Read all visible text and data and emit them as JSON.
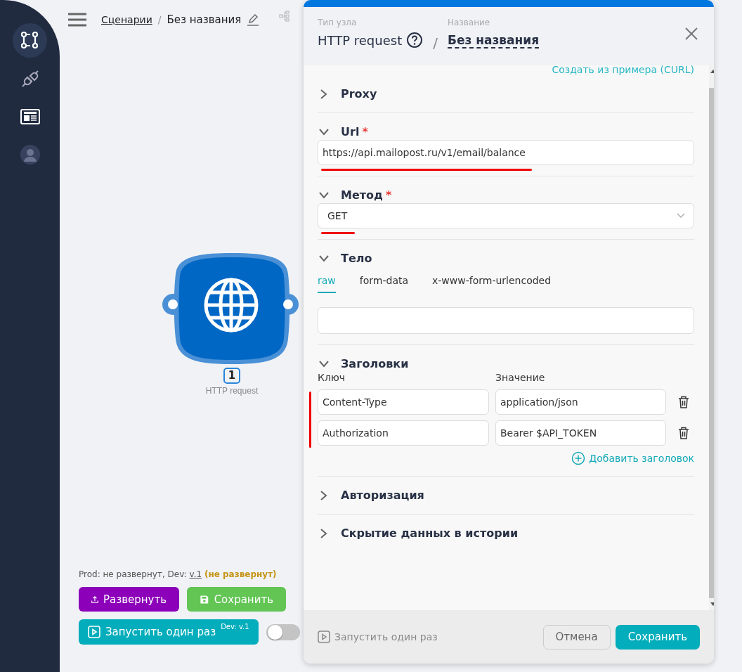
{
  "sidebar": {
    "items": [
      {
        "kind": "scenarios",
        "selected": true
      },
      {
        "kind": "plug",
        "selected": false
      },
      {
        "kind": "news",
        "selected": false
      },
      {
        "kind": "avatar",
        "selected": false
      }
    ]
  },
  "breadcrumb": {
    "link": "Сценарии",
    "separator": "/",
    "current": "Без названия"
  },
  "node": {
    "badge": "1",
    "label": "HTTP request"
  },
  "status": {
    "text": "Prod: не развернут, Dev: ",
    "version": "v.1",
    "state": "(не развернут)"
  },
  "actions": {
    "deploy": "Развернуть",
    "save": "Сохранить",
    "run": "Запустить один раз",
    "run_tag": "Dev: v.1"
  },
  "toggle": {
    "on": false
  },
  "panel": {
    "type_label": "Тип узла",
    "type": "HTTP request",
    "separator": "/",
    "name_label": "Название",
    "name": "Без названия",
    "curl_link": "Создать из примера (CURL)",
    "sections": [
      {
        "title": "Proxy",
        "expanded": false
      },
      {
        "kind": "url",
        "title": "Url",
        "expanded": true,
        "mark": "*",
        "value": "https://api.mailopost.ru/v1/email/balance"
      },
      {
        "kind": "method",
        "title": "Метод",
        "expanded": true,
        "mark": "*",
        "value": "GET"
      },
      {
        "kind": "body",
        "title": "Тело",
        "expanded": true,
        "tabs": [
          {
            "label": "raw",
            "selected": true
          },
          {
            "label": "form-data",
            "selected": false
          },
          {
            "label": "x-www-form-urlencoded",
            "selected": false
          }
        ]
      },
      {
        "kind": "headers",
        "title": "Заголовки",
        "expanded": true,
        "key_label": "Ключ",
        "value_label": "Значение",
        "rows": [
          {
            "key": "Content-Type",
            "value": "application/json"
          },
          {
            "key": "Authorization",
            "value": "Bearer $API_TOKEN"
          }
        ],
        "add": "Добавить заголовок"
      },
      {
        "title": "Авторизация",
        "expanded": false
      },
      {
        "title": "Скрытие данных в истории",
        "expanded": false
      }
    ],
    "footer": {
      "run": "Запустить один раз",
      "cancel": "Отмена",
      "save": "Сохранить"
    }
  }
}
